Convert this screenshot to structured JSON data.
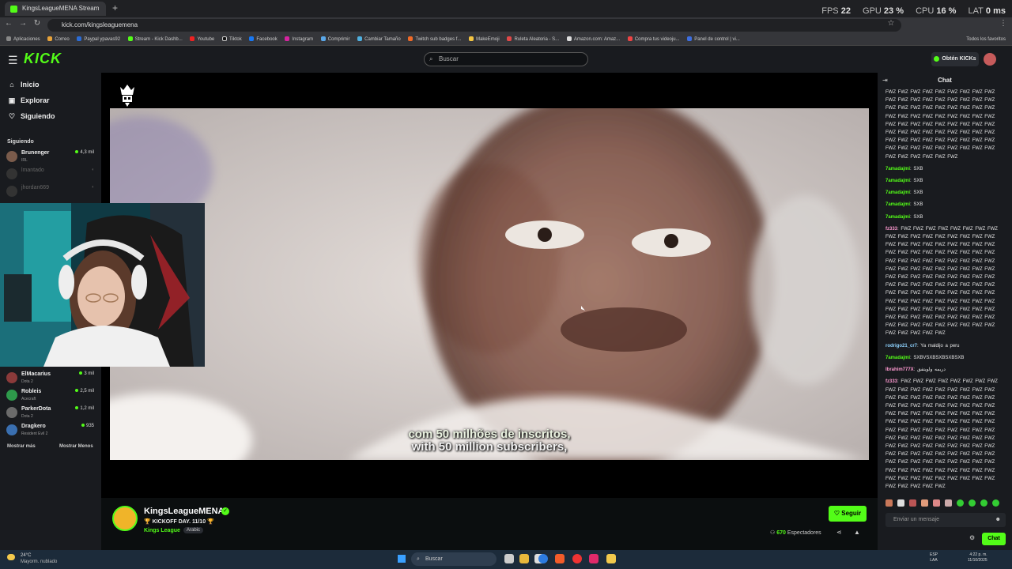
{
  "browser": {
    "tab_title": "KingsLeagueMENA Stream",
    "url": "kick.com/kingsleaguemena",
    "perf": {
      "fps_label": "FPS",
      "fps": "22",
      "gpu_label": "GPU",
      "gpu": "23 %",
      "cpu_label": "CPU",
      "cpu": "16 %",
      "lat_label": "LAT",
      "lat": "0 ms"
    },
    "bookmarks": [
      "Aplicaciones",
      "Correo",
      "Paypal ypavas92",
      "Stream - Kick Dashb...",
      "Youtube",
      "Tiktok",
      "Facebook",
      "Instagram",
      "Comprimir",
      "Cambiar Tamaño",
      "Twitch sub badges f...",
      "MakeEmoji",
      "Ruleta Aleatoria - S...",
      "Amazon.com: Amaz...",
      "Compra tus videoju...",
      "Panel de control | vi..."
    ],
    "all_favorites": "Todos los favoritos"
  },
  "header": {
    "logo": "KICK",
    "search_placeholder": "Buscar",
    "kicks_button": "Obtén KICKs"
  },
  "sidebar": {
    "nav": [
      {
        "label": "Inicio",
        "icon": "home-icon"
      },
      {
        "label": "Explorar",
        "icon": "compass-icon"
      },
      {
        "label": "Siguiendo",
        "icon": "heart-icon"
      }
    ],
    "following_title": "Siguiendo",
    "channels": [
      {
        "name": "Brunenger",
        "category": "IRL",
        "viewers": "4,3 mil",
        "live": true
      },
      {
        "name": "lmantado",
        "category": "",
        "viewers": "",
        "live": false
      },
      {
        "name": "jhordan669",
        "category": "",
        "viewers": "",
        "live": false
      },
      {
        "name": "ElMacarius",
        "category": "Dota 2",
        "viewers": "3 mil",
        "live": true
      },
      {
        "name": "Robleis",
        "category": "Acecraft",
        "viewers": "2,5 mil",
        "live": true
      },
      {
        "name": "ParkerDota",
        "category": "Dota 2",
        "viewers": "1,2 mil",
        "live": true
      },
      {
        "name": "Dragkero",
        "category": "Resident Evil 2",
        "viewers": "935",
        "live": true
      }
    ],
    "show_more": "Mostrar más",
    "show_less": "Mostrar Menos"
  },
  "player": {
    "subtitle_line1": "com 50 milhões de inscritos,",
    "subtitle_line2": "with 50 million subscribers,"
  },
  "channel": {
    "name": "KingsLeagueMENA",
    "title": "🏆 KICKOFF DAY. 11/10 🏆",
    "category": "Kings League",
    "tag": "Arabic",
    "follow_label": "Seguir",
    "viewers": "670",
    "viewers_label": "Espectadores"
  },
  "chat": {
    "title": "Chat",
    "messages": [
      {
        "user": "",
        "color": "#e6e6e6",
        "text": "FWZ FWZ FWZ FWZ FWZ FWZ FWZ FWZ FWZ FWZ FWZ FWZ FWZ FWZ FWZ FWZ FWZ FWZ FWZ FWZ FWZ FWZ FWZ FWZ FWZ FWZ FWZ FWZ FWZ FWZ FWZ FWZ FWZ FWZ FWZ FWZ FWZ FWZ FWZ FWZ FWZ FWZ FWZ FWZ FWZ FWZ FWZ FWZ FWZ FWZ FWZ FWZ FWZ FWZ FWZ FWZ FWZ FWZ FWZ FWZ FWZ FWZ FWZ FWZ FWZ FWZ FWZ FWZ FWZ FWZ FWZ FWZ FWZ FWZ FWZ FWZ FWZ FWZ"
      },
      {
        "user": "7amadajmi",
        "color": "#53fc18",
        "text": "SXB"
      },
      {
        "user": "7amadajmi",
        "color": "#53fc18",
        "text": "SXB"
      },
      {
        "user": "7amadajmi",
        "color": "#53fc18",
        "text": "SXB"
      },
      {
        "user": "7amadajmi",
        "color": "#53fc18",
        "text": "SXB"
      },
      {
        "user": "7amadajmi",
        "color": "#53fc18",
        "text": "SXB"
      },
      {
        "user": "fz333",
        "color": "#ff9ad1",
        "text": "FWZ FWZ FWZ FWZ FWZ FWZ FWZ FWZ FWZ FWZ FWZ FWZ FWZ FWZ FWZ FWZ FWZ FWZ FWZ FWZ FWZ FWZ FWZ FWZ FWZ FWZ FWZ FWZ FWZ FWZ FWZ FWZ FWZ FWZ FWZ FWZ FWZ FWZ FWZ FWZ FWZ FWZ FWZ FWZ FWZ FWZ FWZ FWZ FWZ FWZ FWZ FWZ FWZ FWZ FWZ FWZ FWZ FWZ FWZ FWZ FWZ FWZ FWZ FWZ FWZ FWZ FWZ FWZ FWZ FWZ FWZ FWZ FWZ FWZ FWZ FWZ FWZ FWZ FWZ FWZ FWZ FWZ FWZ FWZ FWZ FWZ FWZ FWZ FWZ FWZ FWZ FWZ FWZ FWZ FWZ FWZ FWZ FWZ FWZ FWZ FWZ FWZ FWZ FWZ FWZ FWZ FWZ FWZ FWZ FWZ FWZ FWZ FWZ FWZ FWZ FWZ FWZ FWZ FWZ FWZ FWZ"
      },
      {
        "user": "rodrigo21_cr7",
        "color": "#8fd3ff",
        "text": "Ya maldijo a peru"
      },
      {
        "user": "7amadajmi",
        "color": "#53fc18",
        "text": "SXBVSXBSXBSXBSXB"
      },
      {
        "user": "Ibrahim777X",
        "color": "#ff9ad1",
        "text": "دريمه ولويتفق"
      },
      {
        "user": "fz333",
        "color": "#ff9ad1",
        "text": "FWZ FWZ FWZ FWZ FWZ FWZ FWZ FWZ FWZ FWZ FWZ FWZ FWZ FWZ FWZ FWZ FWZ FWZ FWZ FWZ FWZ FWZ FWZ FWZ FWZ FWZ FWZ FWZ FWZ FWZ FWZ FWZ FWZ FWZ FWZ FWZ FWZ FWZ FWZ FWZ FWZ FWZ FWZ FWZ FWZ FWZ FWZ FWZ FWZ FWZ FWZ FWZ FWZ FWZ FWZ FWZ FWZ FWZ FWZ FWZ FWZ FWZ FWZ FWZ FWZ FWZ FWZ FWZ FWZ FWZ FWZ FWZ FWZ FWZ FWZ FWZ FWZ FWZ FWZ FWZ FWZ FWZ FWZ FWZ FWZ FWZ FWZ FWZ FWZ FWZ FWZ FWZ FWZ FWZ FWZ FWZ FWZ FWZ FWZ FWZ FWZ FWZ FWZ FWZ FWZ FWZ FWZ FWZ FWZ FWZ FWZ FWZ FWZ FWZ FWZ FWZ FWZ FWZ FWZ FWZ FWZ"
      }
    ],
    "input_placeholder": "Enviar un mensaje",
    "send_label": "Chat"
  },
  "taskbar": {
    "temp": "24°C",
    "weather": "Mayorm. nublado",
    "search_placeholder": "Buscar",
    "lang": "ESP",
    "lang2": "LAA",
    "time": "4:22 p. m.",
    "date": "11/10/2025"
  },
  "colors": {
    "accent": "#53fc18",
    "bg": "#0b0e0f",
    "panel": "#191b1f"
  }
}
